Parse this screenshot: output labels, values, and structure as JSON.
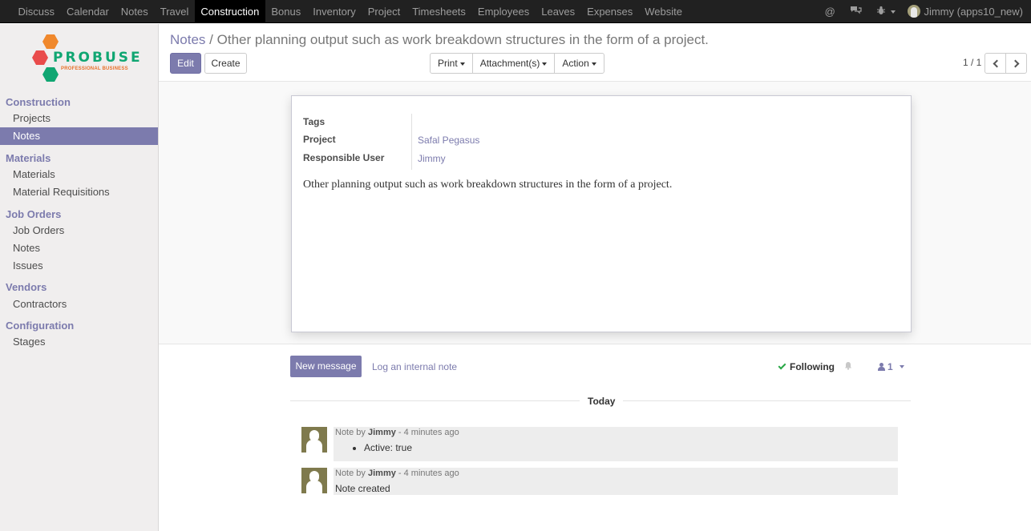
{
  "topbar": {
    "menu": [
      "Discuss",
      "Calendar",
      "Notes",
      "Travel",
      "Construction",
      "Bonus",
      "Inventory",
      "Project",
      "Timesheets",
      "Employees",
      "Leaves",
      "Expenses",
      "Website"
    ],
    "active_index": 4,
    "user_label": "Jimmy (apps10_new)",
    "icons": [
      "at-icon",
      "chat-icon",
      "bug-icon",
      "user-avatar"
    ]
  },
  "sidebar": {
    "logo": {
      "brand": "PROBUSE",
      "tagline": "PROFESSIONAL BUSINESS"
    },
    "sections": [
      {
        "title": "Construction",
        "items": [
          "Projects",
          "Notes"
        ]
      },
      {
        "title": "Materials",
        "items": [
          "Materials",
          "Material Requisitions"
        ]
      },
      {
        "title": "Job Orders",
        "items": [
          "Job Orders",
          "Notes",
          "Issues"
        ]
      },
      {
        "title": "Vendors",
        "items": [
          "Contractors"
        ]
      },
      {
        "title": "Configuration",
        "items": [
          "Stages"
        ]
      }
    ],
    "active_item": "Construction / Notes"
  },
  "control_panel": {
    "breadcrumb_parent": "Notes",
    "breadcrumb_separator": "/",
    "breadcrumb_current": "Other planning output such as work breakdown structures in the form of a project.",
    "edit_label": "Edit",
    "create_label": "Create",
    "print_label": "Print",
    "attachments_label": "Attachment(s)",
    "action_label": "Action",
    "pager": "1 / 1"
  },
  "form": {
    "tags_label": "Tags",
    "tags_value": "",
    "project_label": "Project",
    "project_value": "Safal Pegasus",
    "user_label": "Responsible User",
    "user_value": "Jimmy",
    "body": "Other planning output such as work breakdown structures in the form of a project."
  },
  "chatter": {
    "new_message": "New message",
    "log_note": "Log an internal note",
    "following": "Following",
    "followers_count": "1",
    "date_separator": "Today",
    "messages": [
      {
        "prefix": "Note by",
        "author": "Jimmy",
        "time": "- 4 minutes ago",
        "bullet": "Active: true"
      },
      {
        "prefix": "Note by",
        "author": "Jimmy",
        "time": "- 4 minutes ago",
        "text": "Note created"
      }
    ]
  },
  "colors": {
    "accent": "#7c7bad",
    "topbar": "#212121",
    "sidebar": "#f0eeee"
  }
}
